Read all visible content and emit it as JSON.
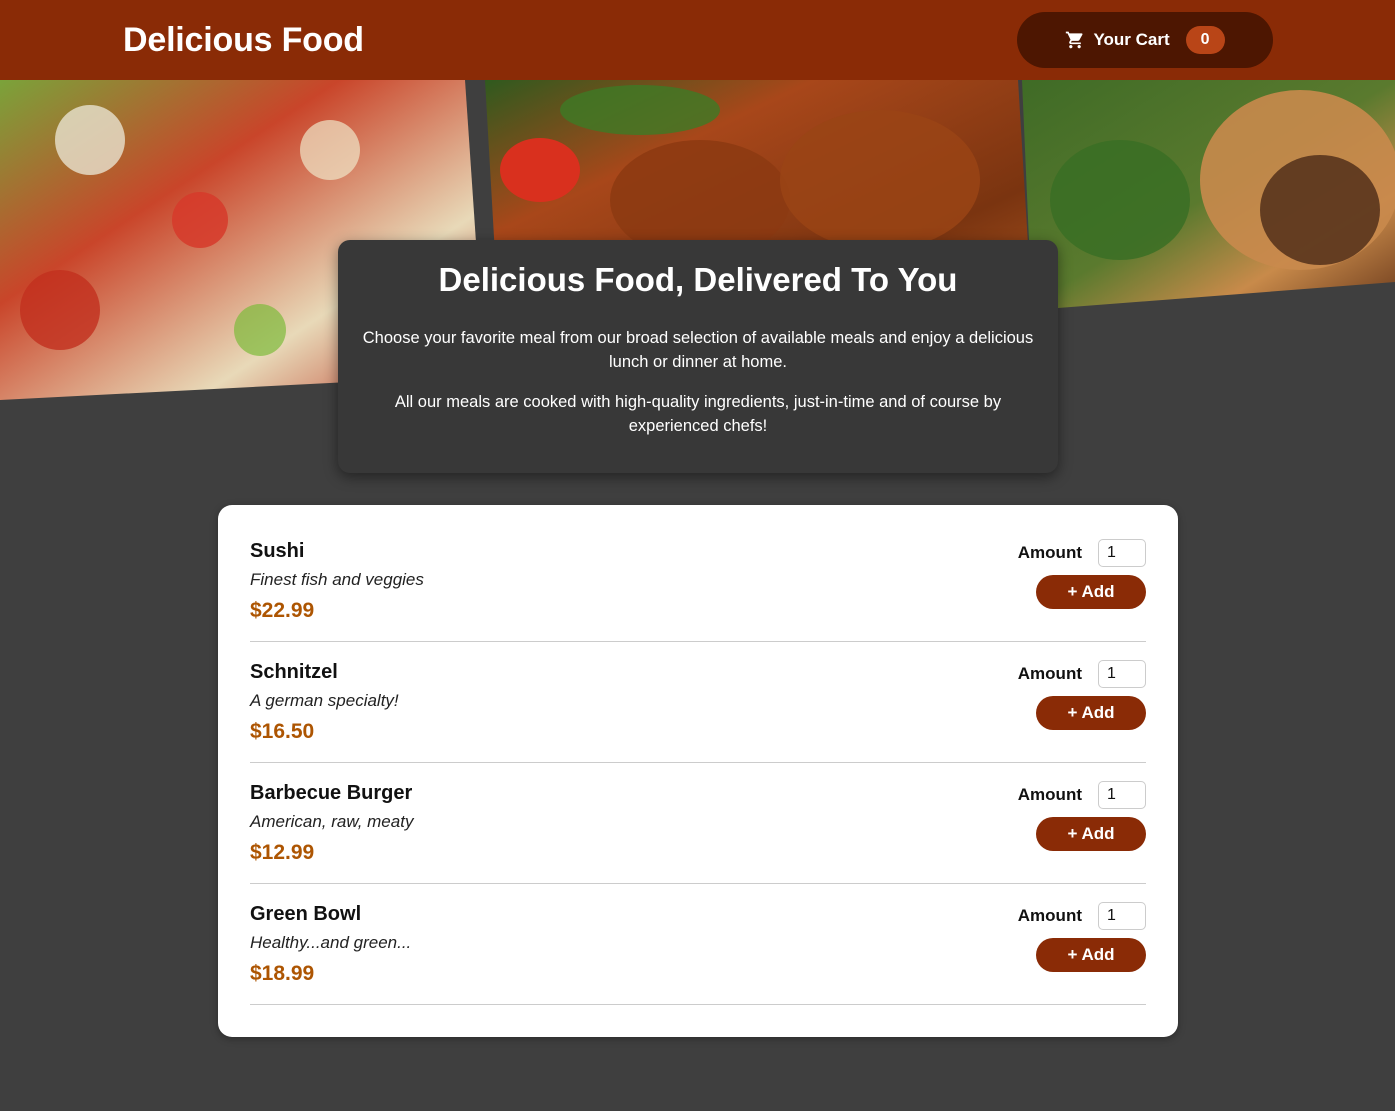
{
  "header": {
    "title": "Delicious Food",
    "cart_label": "Your Cart",
    "cart_count": "0"
  },
  "summary": {
    "heading": "Delicious Food, Delivered To You",
    "paragraph1": "Choose your favorite meal from our broad selection of available meals and enjoy a delicious lunch or dinner at home.",
    "paragraph2": "All our meals are cooked with high-quality ingredients, just-in-time and of course by experienced chefs!"
  },
  "meals": [
    {
      "name": "Sushi",
      "description": "Finest fish and veggies",
      "price": "$22.99",
      "amount_label": "Amount",
      "amount_value": "1",
      "add_label": "+ Add"
    },
    {
      "name": "Schnitzel",
      "description": "A german specialty!",
      "price": "$16.50",
      "amount_label": "Amount",
      "amount_value": "1",
      "add_label": "+ Add"
    },
    {
      "name": "Barbecue Burger",
      "description": "American, raw, meaty",
      "price": "$12.99",
      "amount_label": "Amount",
      "amount_value": "1",
      "add_label": "+ Add"
    },
    {
      "name": "Green Bowl",
      "description": "Healthy...and green...",
      "price": "$18.99",
      "amount_label": "Amount",
      "amount_value": "1",
      "add_label": "+ Add"
    }
  ],
  "colors": {
    "header": "#8a2b06",
    "cart_button": "#4d1601",
    "cart_badge": "#b94517",
    "price": "#ad5502",
    "page_background": "#3f3f3f"
  },
  "icons": {
    "cart": "shopping-cart-icon"
  }
}
